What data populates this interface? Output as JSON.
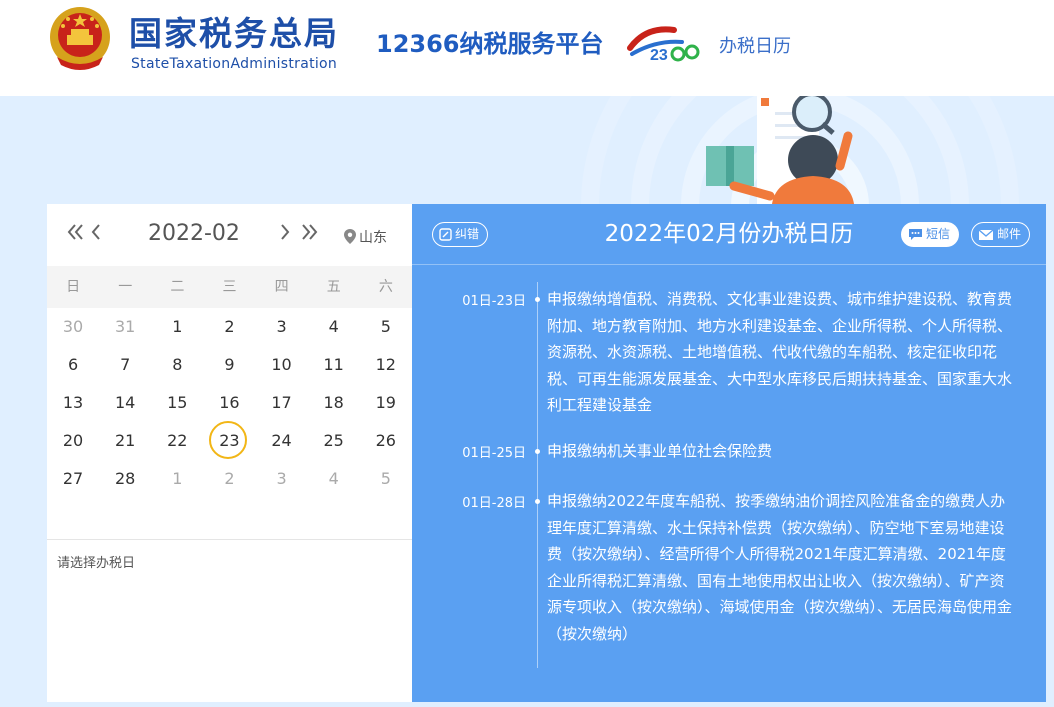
{
  "header": {
    "brand_cn": "国家税务总局",
    "brand_en": "StateTaxationAdministration",
    "platform_title": "12366纳税服务平台",
    "page_link": "办税日历"
  },
  "calendar": {
    "month_label": "2022-02",
    "location": "山东",
    "weekdays": [
      "日",
      "一",
      "二",
      "三",
      "四",
      "五",
      "六"
    ],
    "weeks": [
      [
        "30",
        "31",
        "1",
        "2",
        "3",
        "4",
        "5"
      ],
      [
        "6",
        "7",
        "8",
        "9",
        "10",
        "11",
        "12"
      ],
      [
        "13",
        "14",
        "15",
        "16",
        "17",
        "18",
        "19"
      ],
      [
        "20",
        "21",
        "22",
        "23",
        "24",
        "25",
        "26"
      ],
      [
        "27",
        "28",
        "1",
        "2",
        "3",
        "4",
        "5"
      ]
    ],
    "today": "23",
    "select_hint": "请选择办税日"
  },
  "schedule": {
    "title": "2022年02月份办税日历",
    "correction_label": "纠错",
    "sms_label": "短信",
    "email_label": "邮件",
    "entries": [
      {
        "date": "01日-23日",
        "text": "申报缴纳增值税、消费税、文化事业建设费、城市维护建设税、教育费附加、地方教育附加、地方水利建设基金、企业所得税、个人所得税、资源税、水资源税、土地增值税、代收代缴的车船税、核定征收印花税、可再生能源发展基金、大中型水库移民后期扶持基金、国家重大水利工程建设基金"
      },
      {
        "date": "01日-25日",
        "text": "申报缴纳机关事业单位社会保险费"
      },
      {
        "date": "01日-28日",
        "text": "申报缴纳2022年度车船税、按季缴纳油价调控风险准备金的缴费人办理年度汇算清缴、水土保持补偿费（按次缴纳）、防空地下室易地建设费（按次缴纳）、经营所得个人所得税2021年度汇算清缴、2021年度企业所得税汇算清缴、国有土地使用权出让收入（按次缴纳）、矿产资源专项收入（按次缴纳）、海域使用金（按次缴纳）、无居民海岛使用金（按次缴纳）"
      }
    ]
  },
  "colors": {
    "brand_blue": "#1e4fa8",
    "panel_blue": "#5aa0f2",
    "today_ring": "#f2b616",
    "banner_bg": "#e0efff"
  },
  "icons": [
    "national-emblem-icon",
    "double-chevron-left-icon",
    "chevron-left-icon",
    "chevron-right-icon",
    "double-chevron-right-icon",
    "location-pin-icon",
    "edit-icon",
    "chat-icon",
    "mail-icon"
  ]
}
